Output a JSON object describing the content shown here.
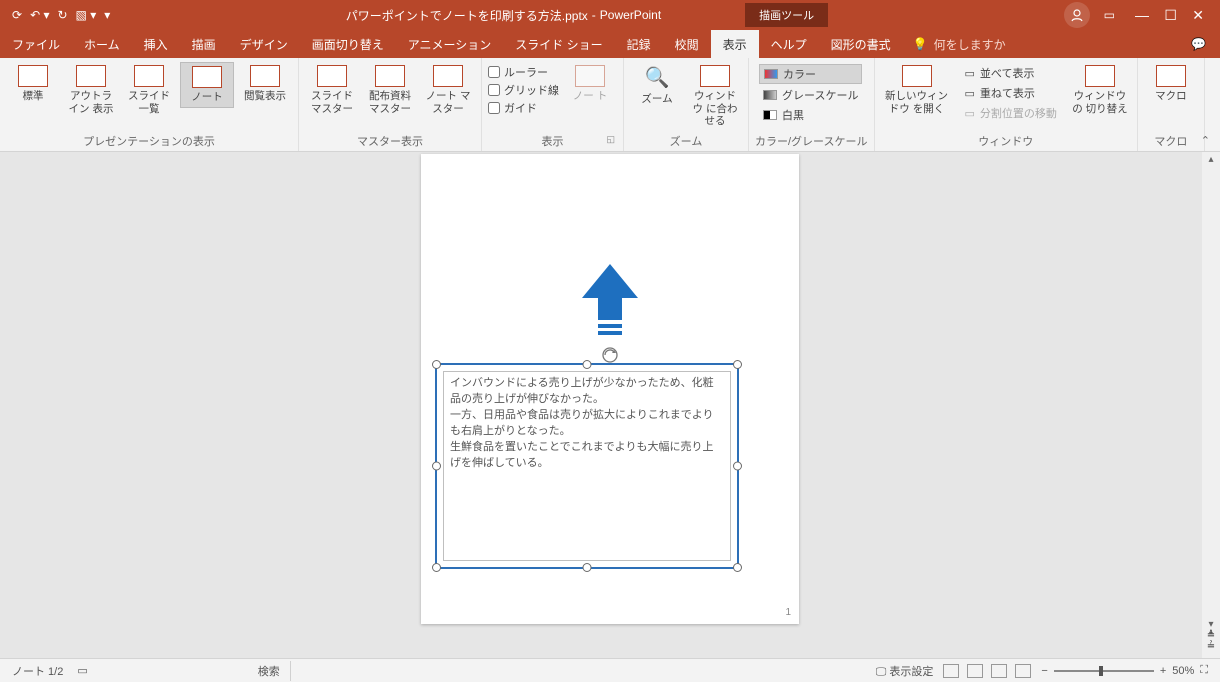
{
  "title": {
    "filename": "パワーポイントでノートを印刷する方法.pptx",
    "app": "PowerPoint",
    "context_tool": "描画ツール"
  },
  "menu": {
    "tabs": [
      "ファイル",
      "ホーム",
      "挿入",
      "描画",
      "デザイン",
      "画面切り替え",
      "アニメーション",
      "スライド ショー",
      "記録",
      "校閲",
      "表示",
      "ヘルプ",
      "図形の書式"
    ],
    "active": "表示",
    "tellme": "何をしますか"
  },
  "ribbon": {
    "presentation_views": {
      "label": "プレゼンテーションの表示",
      "normal": "標準",
      "outline": "アウトライン\n表示",
      "sorter": "スライド\n一覧",
      "notes": "ノート",
      "reading": "閲覧表示"
    },
    "master_views": {
      "label": "マスター表示",
      "slide": "スライド\nマスター",
      "handout": "配布資料\nマスター",
      "notes": "ノート\nマスター"
    },
    "show": {
      "label": "表示",
      "ruler": "ルーラー",
      "grid": "グリッド線",
      "guides": "ガイド",
      "notes_btn": "ノー\nト"
    },
    "zoom": {
      "label": "ズーム",
      "zoom": "ズーム",
      "fit": "ウィンドウ\nに合わせる"
    },
    "color": {
      "label": "カラー/グレースケール",
      "color": "カラー",
      "gray": "グレースケール",
      "bw": "白黒"
    },
    "window": {
      "label": "ウィンドウ",
      "new": "新しいウィンドウ\nを開く",
      "arrange": "並べて表示",
      "cascade": "重ねて表示",
      "split": "分割位置の移動",
      "switch": "ウィンドウの\n切り替え"
    },
    "macro": {
      "label": "マクロ",
      "btn": "マクロ"
    }
  },
  "page": {
    "number": "1",
    "text": "インバウンドによる売り上げが少なかったため、化粧品の売り上げが伸びなかった。\n一方、日用品や食品は売りが拡大によりこれまでよりも右肩上がりとなった。\n生鮮食品を置いたことでこれまでよりも大幅に売り上げを伸ばしている。"
  },
  "status": {
    "notes": "ノート 1/2",
    "search": "検索",
    "display_settings": "表示設定",
    "zoom_pct": "50%"
  }
}
